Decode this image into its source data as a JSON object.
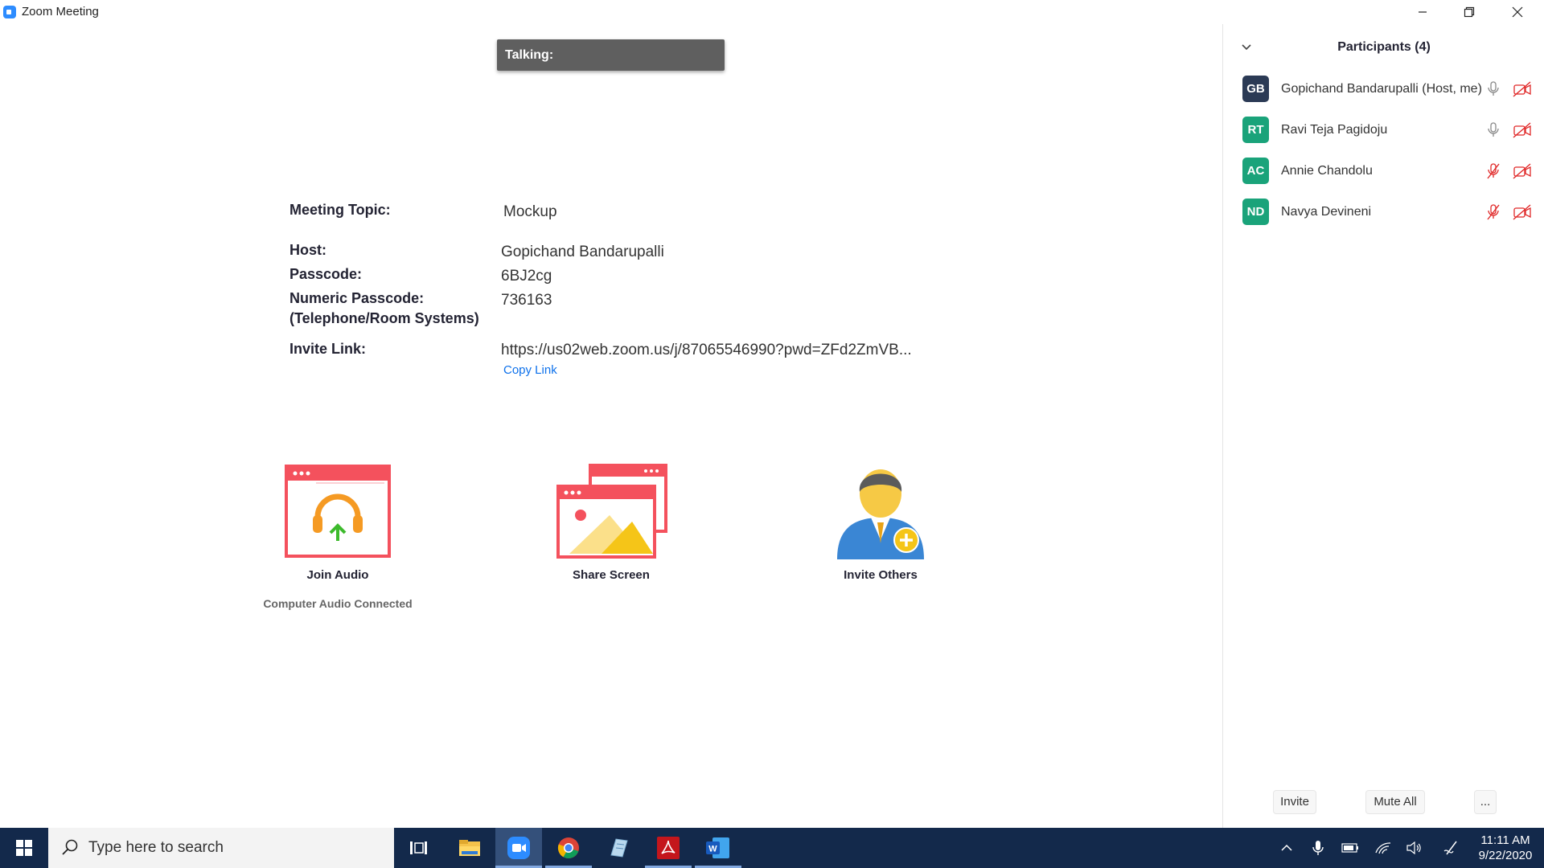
{
  "window": {
    "title": "Zoom Meeting"
  },
  "talking_label": "Talking:",
  "meeting": {
    "topic_label": "Meeting Topic:",
    "topic": "Mockup",
    "host_label": "Host:",
    "host": "Gopichand Bandarupalli",
    "passcode_label": "Passcode:",
    "passcode": "6BJ2cg",
    "numeric_passcode_label_1": "Numeric Passcode:",
    "numeric_passcode_label_2": "(Telephone/Room Systems)",
    "numeric_passcode": "736163",
    "invite_link_label": "Invite Link:",
    "invite_link": "https://us02web.zoom.us/j/87065546990?pwd=ZFd2ZmVB...",
    "copy_link": "Copy Link"
  },
  "actions": {
    "join_audio": "Join Audio",
    "audio_status": "Computer Audio Connected",
    "share_screen": "Share Screen",
    "invite_others": "Invite Others"
  },
  "participants": {
    "title": "Participants (4)",
    "list": [
      {
        "initials": "GB",
        "name": "Gopichand Bandarupalli (Host, me)",
        "color": "#2B3A55",
        "mic": "on",
        "video": "off"
      },
      {
        "initials": "RT",
        "name": "Ravi Teja Pagidoju",
        "color": "#1AA37A",
        "mic": "on",
        "video": "off"
      },
      {
        "initials": "AC",
        "name": "Annie Chandolu",
        "color": "#1AA37A",
        "mic": "muted",
        "video": "off"
      },
      {
        "initials": "ND",
        "name": "Navya Devineni",
        "color": "#1AA37A",
        "mic": "muted",
        "video": "off"
      }
    ],
    "invite_button": "Invite",
    "mute_all_button": "Mute All",
    "more_button": "..."
  },
  "taskbar": {
    "search_placeholder": "Type here to search",
    "time": "11:11 AM",
    "date": "9/22/2020",
    "apps": [
      "task-view",
      "file-explorer",
      "zoom",
      "chrome",
      "notepad",
      "acrobat",
      "word"
    ]
  },
  "colors": {
    "accent": "#0E71EB",
    "muted_red": "#E02828",
    "taskbar": "#13294b"
  }
}
